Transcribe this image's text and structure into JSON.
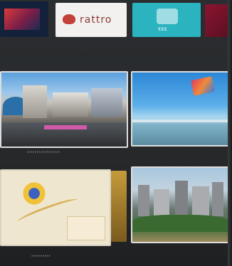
{
  "apps": [
    {
      "label": "",
      "color": "#14213b"
    },
    {
      "label": "rattro",
      "color": "#f2f1ef"
    },
    {
      "label": "ɛɛɛ",
      "color": "#2bb3c0"
    },
    {
      "label": "",
      "color": "#8b1530"
    }
  ],
  "row1": {
    "caption": "ʻʻʻʻʻʻʻʻʻʻʻʻʻʻʻʻʻ"
  },
  "row2": {
    "caption": "ʻʻʻʻʻʻʻʻʻʻ"
  }
}
